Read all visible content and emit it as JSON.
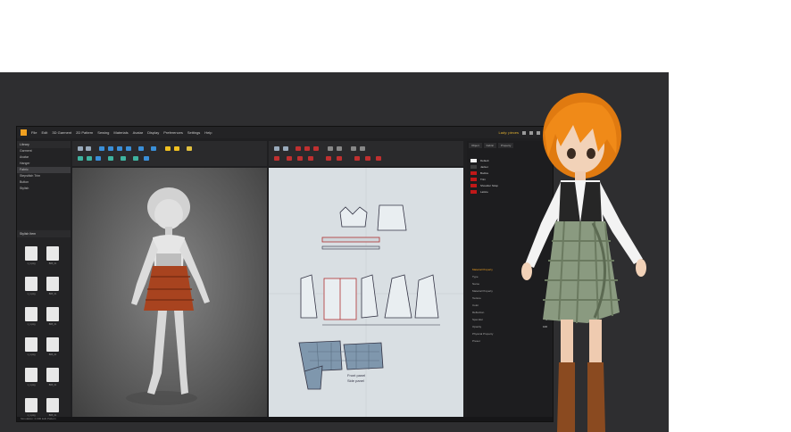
{
  "app": {
    "menu": [
      "File",
      "Edit",
      "3D Garment",
      "2D Pattern",
      "Sewing",
      "Materials",
      "Avatar",
      "Display",
      "Preferences",
      "Settings",
      "Help"
    ],
    "user": "Lady: pieces",
    "status": "Simulation: 0.000  Edit  Pattern"
  },
  "sidebar": {
    "title": "Library",
    "items": [
      "Garment",
      "Avatar",
      "Hanger",
      "Fabric",
      "Stepstitch Trim",
      "Button",
      "Stylish"
    ],
    "selected_index": 3,
    "thumbs_title": "Stylish Item",
    "thumbs": [
      "1_1.png",
      "B65_01",
      "1_1.png",
      "B65_01",
      "1_1.png",
      "B65_01",
      "1_1.png",
      "B65_01",
      "1_1.png",
      "B65_01",
      "1_1.png",
      "B65_01"
    ]
  },
  "views": {
    "three_d_title": "3D Garment",
    "two_d_title": "2D Pattern",
    "pattern_label_1": "Front panel",
    "pattern_label_2": "Side panel"
  },
  "panel": {
    "tabs": [
      "Object",
      "Fabric",
      "Property"
    ],
    "fabrics": [
      {
        "name": "Default",
        "color": "#f2f2f2"
      },
      {
        "name": "Jacket",
        "color": "#404040"
      },
      {
        "name": "Bodice",
        "color": "#c01818"
      },
      {
        "name": "Trim",
        "color": "#c01818"
      },
      {
        "name": "Shoulder Strap",
        "color": "#c01818"
      },
      {
        "name": "Lattice",
        "color": "#c01818"
      }
    ],
    "props_title": "Material Property",
    "props": [
      {
        "label": "Type",
        "value": ""
      },
      {
        "label": "Name",
        "value": ""
      },
      {
        "label": "Material Property",
        "value": ""
      },
      {
        "label": "Texture",
        "value": "0"
      },
      {
        "label": "Color",
        "value": "0"
      },
      {
        "label": "Reflection",
        "value": "0"
      },
      {
        "label": "Specular",
        "value": "0"
      },
      {
        "label": "Opacity",
        "value": "100"
      },
      {
        "label": "Physical Property",
        "value": ""
      },
      {
        "label": "Preset",
        "value": ""
      }
    ]
  },
  "colors": {
    "accent": "#f0a020",
    "skirt_red": "#a8431f",
    "plaid_green": "#8a9a80",
    "pattern_bg": "#d9dfe3"
  }
}
